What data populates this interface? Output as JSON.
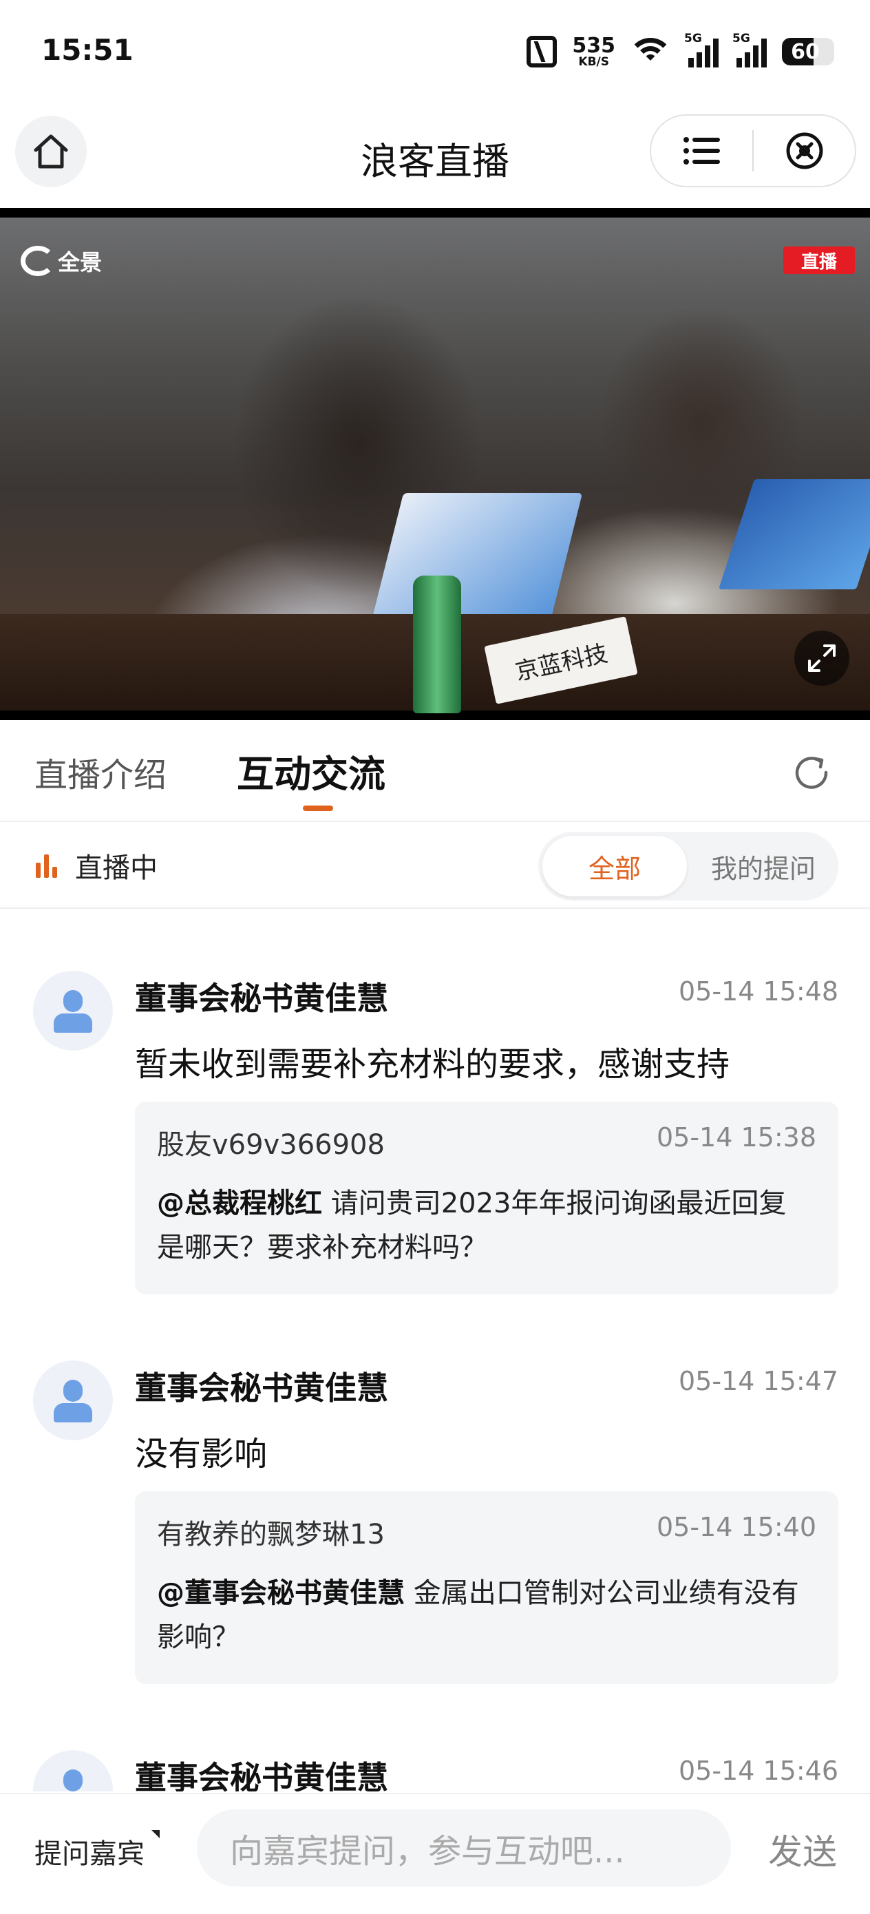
{
  "status_bar": {
    "time": "15:51",
    "net_speed_value": "535",
    "net_speed_unit": "KB/S",
    "signal1_label": "5G",
    "signal2_label": "5G",
    "battery_level": "60",
    "battery_fraction": 0.6
  },
  "header": {
    "title": "浪客直播",
    "home_icon": "home-icon",
    "menu_icon": "list-icon",
    "close_icon": "close-circle-icon"
  },
  "video": {
    "brand_label": "全景",
    "live_badge": "直播",
    "nameplate": "京蓝科技",
    "fullscreen_icon": "fullscreen-icon"
  },
  "tabs": {
    "items": [
      {
        "label": "直播介绍",
        "active": false
      },
      {
        "label": "互动交流",
        "active": true
      }
    ],
    "refresh_icon": "refresh-icon",
    "accent_color": "#e0621f"
  },
  "filter": {
    "live_status": "直播中",
    "options": [
      {
        "label": "全部",
        "selected": true
      },
      {
        "label": "我的提问",
        "selected": false
      }
    ]
  },
  "feed": {
    "posts": [
      {
        "author": "董事会秘书黄佳慧",
        "time": "05-14 15:48",
        "answer": "暂未收到需要补充材料的要求，感谢支持",
        "question": {
          "user": "股友v69v366908",
          "time": "05-14 15:38",
          "mention": "@总裁程桃红",
          "text": " 请问贵司2023年年报问询函最近回复是哪天？要求补充材料吗？"
        }
      },
      {
        "author": "董事会秘书黄佳慧",
        "time": "05-14 15:47",
        "answer": "没有影响",
        "question": {
          "user": "有教养的飘梦琳13",
          "time": "05-14 15:40",
          "mention": "@董事会秘书黄佳慧",
          "text": " 金属出口管制对公司业绩有没有影响？"
        }
      },
      {
        "author": "董事会秘书黄佳慧",
        "time": "05-14 15:46"
      }
    ]
  },
  "bottom_bar": {
    "ask_guest": "提问嘉宾",
    "input_placeholder": "向嘉宾提问，参与互动吧...",
    "send_label": "发送"
  }
}
